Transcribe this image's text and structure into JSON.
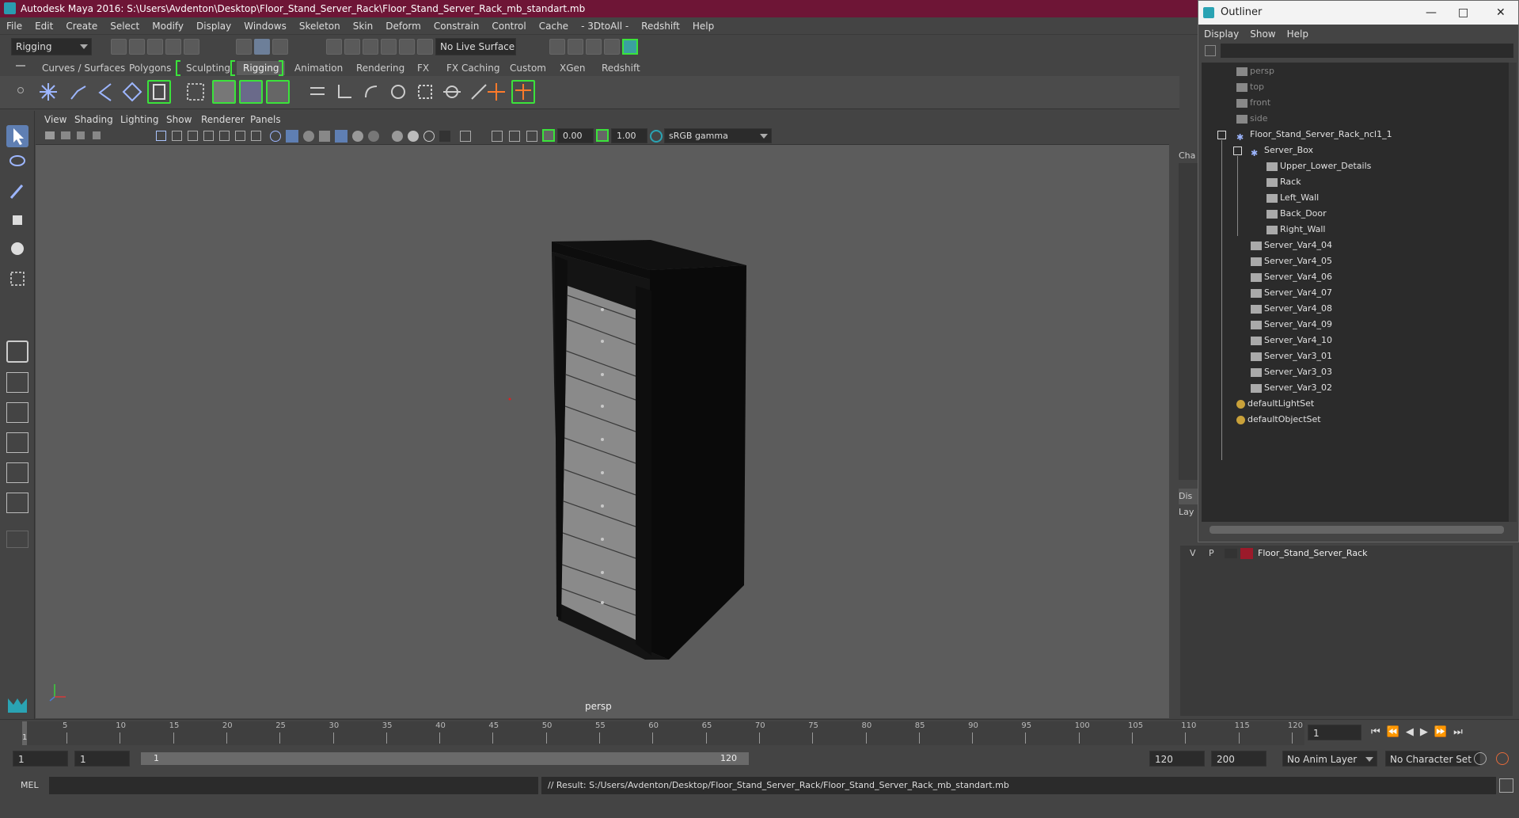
{
  "window": {
    "title": "Autodesk Maya 2016: S:\\Users\\Avdenton\\Desktop\\Floor_Stand_Server_Rack\\Floor_Stand_Server_Rack_mb_standart.mb"
  },
  "menubar": [
    "File",
    "Edit",
    "Create",
    "Select",
    "Modify",
    "Display",
    "Windows",
    "Skeleton",
    "Skin",
    "Deform",
    "Constrain",
    "Control",
    "Cache",
    "- 3DtoAll -",
    "Redshift",
    "Help"
  ],
  "statusline": {
    "menu_set": "Rigging",
    "live_surface": "No Live Surface"
  },
  "shelf_tabs": [
    "Curves / Surfaces",
    "Polygons",
    "Sculpting",
    "Rigging",
    "Animation",
    "Rendering",
    "FX",
    "FX Caching",
    "Custom",
    "XGen",
    "Redshift"
  ],
  "shelf_active_tab": "Rigging",
  "panel_menu": [
    "View",
    "Shading",
    "Lighting",
    "Show",
    "Renderer",
    "Panels"
  ],
  "panel_toolbar": {
    "exposure": "0.00",
    "gamma": "1.00",
    "color_space": "sRGB gamma"
  },
  "viewport": {
    "camera_label": "persp"
  },
  "timeslider": {
    "ticks": [
      "5",
      "10",
      "15",
      "20",
      "25",
      "30",
      "35",
      "40",
      "45",
      "50",
      "55",
      "60",
      "65",
      "70",
      "75",
      "80",
      "85",
      "90",
      "95",
      "100",
      "105",
      "110",
      "115",
      "120"
    ],
    "current_frame": "1",
    "current_frame_field": "1"
  },
  "rangeslider": {
    "start_field": "1",
    "start_inner": "1",
    "range_start_label": "1",
    "range_end_label": "120",
    "end_inner": "120",
    "end_field": "200",
    "anim_layer": "No Anim Layer",
    "character_set": "No Character Set"
  },
  "cmdline": {
    "language": "MEL",
    "result": "// Result: S:/Users/Avdenton/Desktop/Floor_Stand_Server_Rack/Floor_Stand_Server_Rack_mb_standart.mb"
  },
  "outliner": {
    "title": "Outliner",
    "menu": [
      "Display",
      "Show",
      "Help"
    ],
    "nodes": [
      {
        "label": "persp",
        "type": "camera"
      },
      {
        "label": "top",
        "type": "camera"
      },
      {
        "label": "front",
        "type": "camera"
      },
      {
        "label": "side",
        "type": "camera"
      },
      {
        "label": "Floor_Stand_Server_Rack_ncl1_1",
        "type": "group"
      },
      {
        "label": "Server_Box",
        "type": "group"
      },
      {
        "label": "Upper_Lower_Details",
        "type": "mesh"
      },
      {
        "label": "Rack",
        "type": "mesh"
      },
      {
        "label": "Left_Wall",
        "type": "mesh"
      },
      {
        "label": "Back_Door",
        "type": "mesh"
      },
      {
        "label": "Right_Wall",
        "type": "mesh"
      },
      {
        "label": "Server_Var4_04",
        "type": "mesh"
      },
      {
        "label": "Server_Var4_05",
        "type": "mesh"
      },
      {
        "label": "Server_Var4_06",
        "type": "mesh"
      },
      {
        "label": "Server_Var4_07",
        "type": "mesh"
      },
      {
        "label": "Server_Var4_08",
        "type": "mesh"
      },
      {
        "label": "Server_Var4_09",
        "type": "mesh"
      },
      {
        "label": "Server_Var4_10",
        "type": "mesh"
      },
      {
        "label": "Server_Var3_01",
        "type": "mesh"
      },
      {
        "label": "Server_Var3_03",
        "type": "mesh"
      },
      {
        "label": "Server_Var3_02",
        "type": "mesh"
      },
      {
        "label": "defaultLightSet",
        "type": "set"
      },
      {
        "label": "defaultObjectSet",
        "type": "set"
      }
    ]
  },
  "channel_box": {
    "tab_short": "Cha",
    "display_short": "Dis",
    "layers_short": "Lay"
  },
  "layers": [
    {
      "visible": "V",
      "playback": "P",
      "name": "Floor_Stand_Server_Rack",
      "color": "#9b1a2a"
    }
  ]
}
